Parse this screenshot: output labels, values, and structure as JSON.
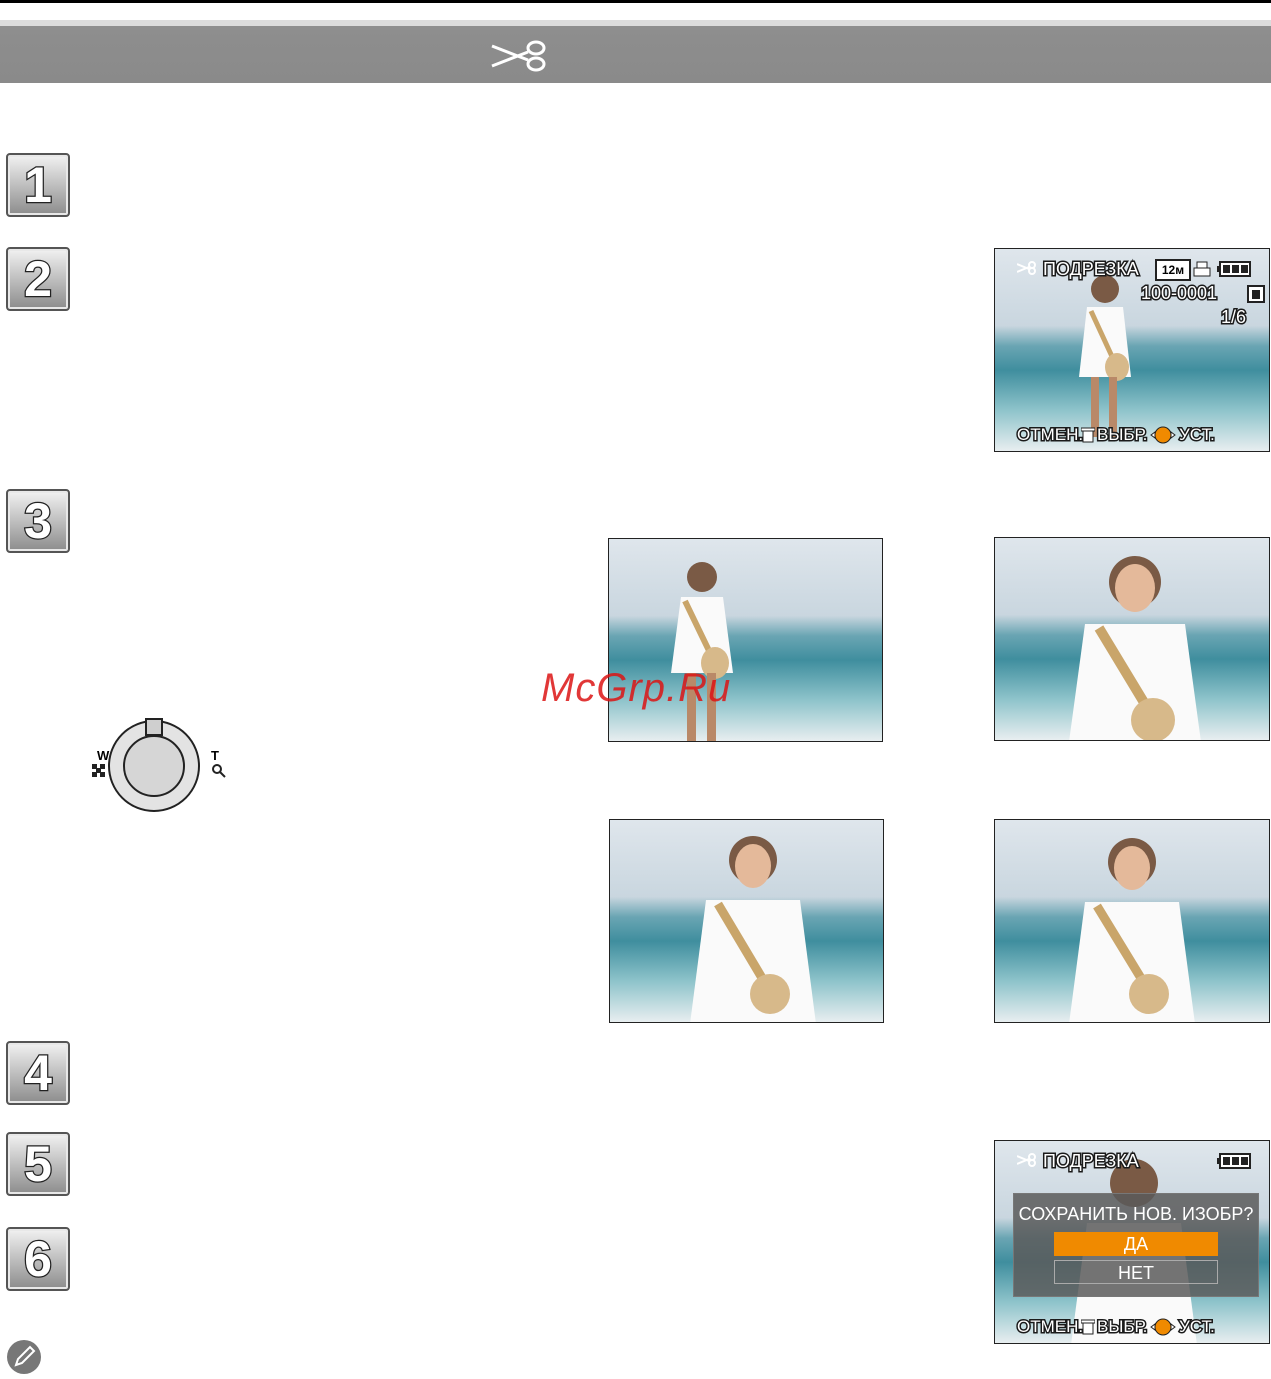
{
  "steps": [
    "1",
    "2",
    "3",
    "4",
    "5",
    "6"
  ],
  "screen1": {
    "title": "ПОДРЕЗКА",
    "size_badge": "12м",
    "file_number": "100-0001",
    "page": "1/6",
    "footer": "ОТМЕН.",
    "footer_select": "ВЫБР.",
    "footer_set": "УСТ."
  },
  "zoom_lever": {
    "w_label": "W",
    "t_label": "T"
  },
  "watermark": "McGrp.Ru",
  "screen2": {
    "title": "ПОДРЕЗКА",
    "question": "СОХРАНИТЬ НОВ. ИЗОБР?",
    "yes": "ДА",
    "no": "НЕТ",
    "footer": "ОТМЕН.",
    "footer_select": "ВЫБР.",
    "footer_set": "УСТ."
  },
  "icons": [
    "scissors-icon",
    "trash-icon",
    "dial-icon",
    "battery-icon",
    "print-icon",
    "protect-icon",
    "pencil-note-icon",
    "zoom-lever-icon"
  ],
  "colors": {
    "highlight": "#f08a00",
    "header_bar": "#8a8a8a"
  }
}
